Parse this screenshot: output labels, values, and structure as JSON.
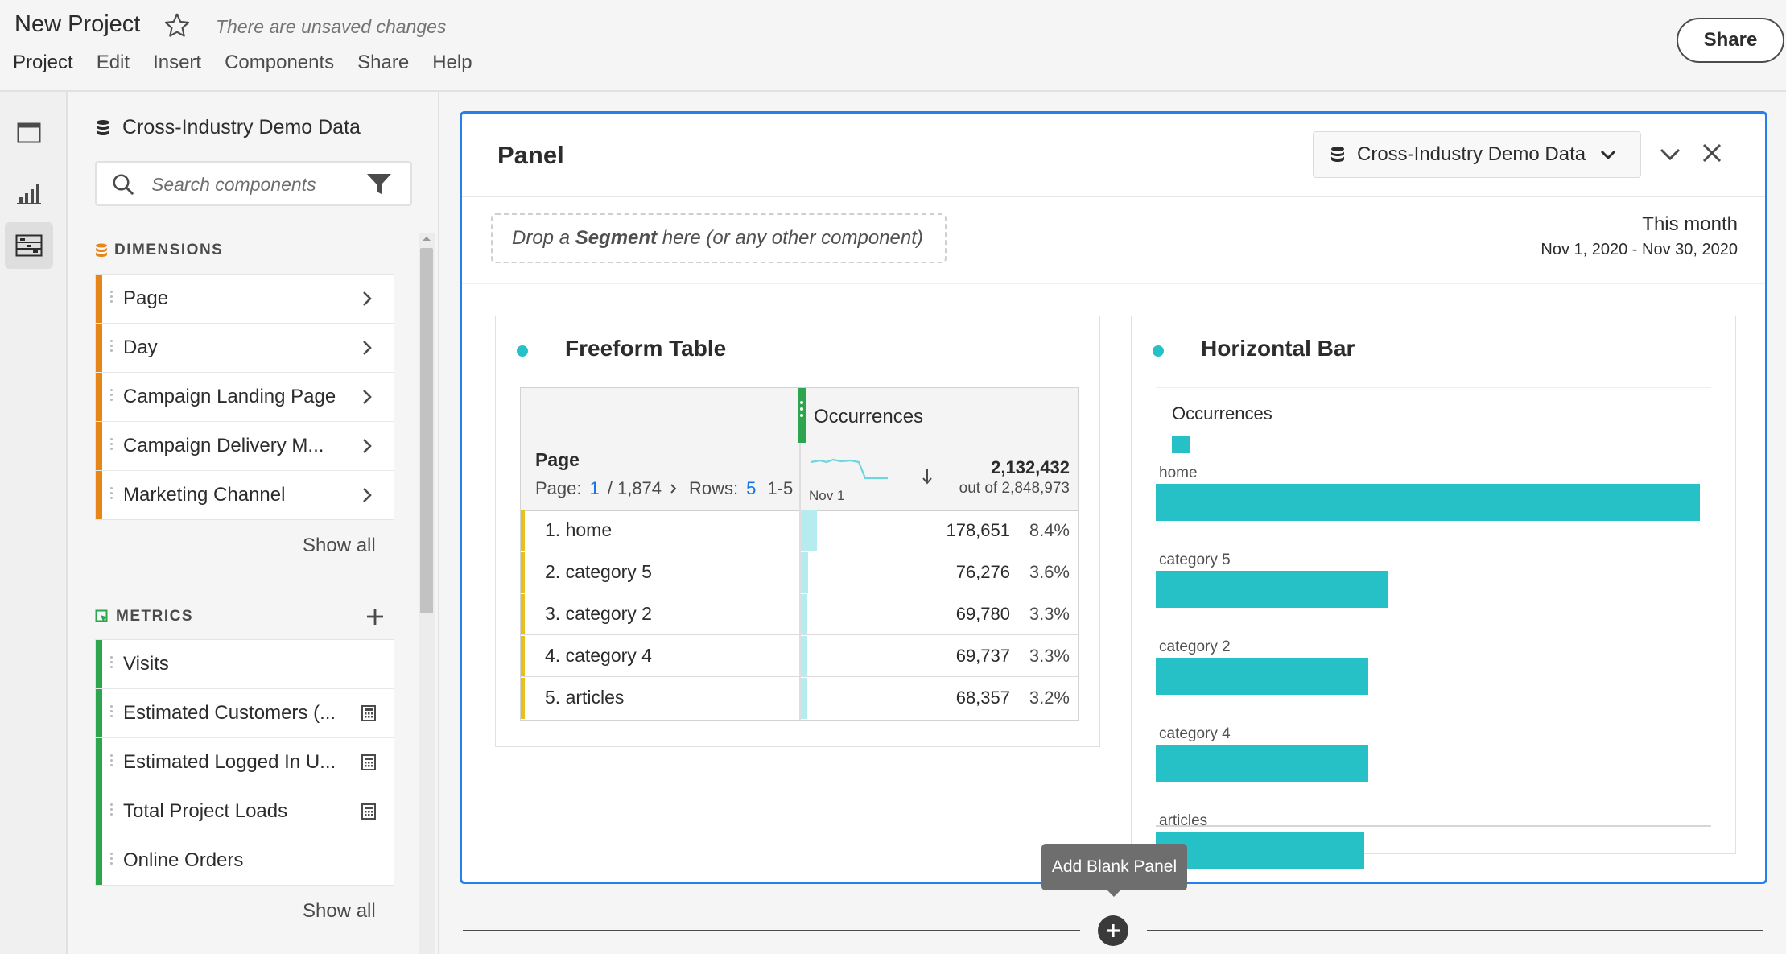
{
  "header": {
    "project_title": "New Project",
    "unsaved_note": "There are unsaved changes",
    "menu": [
      "Project",
      "Edit",
      "Insert",
      "Components",
      "Share",
      "Help"
    ],
    "share_label": "Share"
  },
  "left_rail": {
    "items": [
      {
        "icon": "panels-icon",
        "active": false
      },
      {
        "icon": "visualizations-icon",
        "active": false
      },
      {
        "icon": "components-icon",
        "active": true
      }
    ]
  },
  "sidebar": {
    "report_suite": "Cross-Industry Demo Data",
    "search_placeholder": "Search components",
    "dimensions": {
      "title": "DIMENSIONS",
      "color": "#e68619",
      "items": [
        "Page",
        "Day",
        "Campaign Landing Page",
        "Campaign Delivery M...",
        "Marketing Channel"
      ],
      "show_all": "Show all"
    },
    "metrics": {
      "title": "METRICS",
      "color": "#2da44e",
      "items": [
        {
          "label": "Visits",
          "calculated": false
        },
        {
          "label": "Estimated Customers (...",
          "calculated": true
        },
        {
          "label": "Estimated Logged In U...",
          "calculated": true
        },
        {
          "label": "Total Project Loads",
          "calculated": true
        },
        {
          "label": "Online Orders",
          "calculated": false
        }
      ],
      "show_all": "Show all"
    }
  },
  "panel": {
    "title": "Panel",
    "report_suite": "Cross-Industry Demo Data",
    "drop_zone": {
      "prefix": "Drop a ",
      "bold": "Segment",
      "suffix": " here (or any other component)"
    },
    "date_label": "This month",
    "date_range": "Nov 1, 2020 - Nov 30, 2020",
    "accent_color": "#2680eb"
  },
  "freeform_table": {
    "title": "Freeform Table",
    "metric_header": "Occurrences",
    "dimension_header": "Page",
    "pager": {
      "page_label": "Page:",
      "page": "1",
      "page_total": "/ 1,874",
      "rows_label": "Rows:",
      "rows": "5",
      "range": "1-5"
    },
    "sparkline_label": "Nov 1",
    "total": "2,132,432",
    "total_of": "out of 2,848,973",
    "rows": [
      {
        "label": "1. home",
        "value": "178,651",
        "pct": "8.4%",
        "fraction": 0.084
      },
      {
        "label": "2. category 5",
        "value": "76,276",
        "pct": "3.6%",
        "fraction": 0.036
      },
      {
        "label": "3. category 2",
        "value": "69,780",
        "pct": "3.3%",
        "fraction": 0.033
      },
      {
        "label": "4. category 4",
        "value": "69,737",
        "pct": "3.3%",
        "fraction": 0.033
      },
      {
        "label": "5. articles",
        "value": "68,357",
        "pct": "3.2%",
        "fraction": 0.032
      }
    ]
  },
  "horizontal_bar": {
    "title": "Horizontal Bar",
    "bar_color": "#26c0c7"
  },
  "chart_data": {
    "type": "bar",
    "orientation": "horizontal",
    "categories": [
      "home",
      "category 5",
      "category 2",
      "category 4",
      "articles"
    ],
    "series": [
      {
        "name": "Occurrences",
        "values": [
          178651,
          76276,
          69780,
          69737,
          68357
        ]
      }
    ],
    "xlim": [
      0,
      178651
    ],
    "grid": false,
    "legend": "top-left"
  },
  "add_panel": {
    "tooltip": "Add Blank Panel"
  }
}
